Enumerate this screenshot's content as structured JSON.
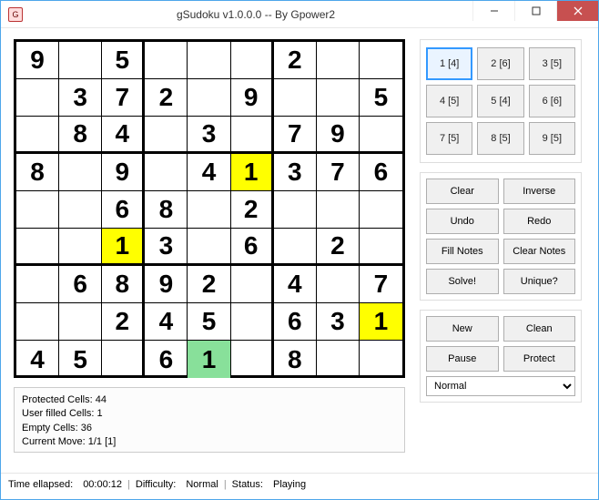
{
  "window": {
    "title": "gSudoku v1.0.0.0 -- By Gpower2",
    "app_icon_text": "G"
  },
  "sudoku": {
    "grid": [
      [
        "9",
        "",
        "5",
        "",
        "",
        "",
        "2",
        "",
        ""
      ],
      [
        "",
        "3",
        "7",
        "2",
        "",
        "9",
        "",
        "",
        "5"
      ],
      [
        "",
        "8",
        "4",
        "",
        "3",
        "",
        "7",
        "9",
        ""
      ],
      [
        "8",
        "",
        "9",
        "",
        "4",
        "1",
        "3",
        "7",
        "6"
      ],
      [
        "",
        "",
        "6",
        "8",
        "",
        "2",
        "",
        "",
        ""
      ],
      [
        "",
        "",
        "1",
        "3",
        "",
        "6",
        "",
        "2",
        ""
      ],
      [
        "",
        "6",
        "8",
        "9",
        "2",
        "",
        "4",
        "",
        "7"
      ],
      [
        "",
        "",
        "2",
        "4",
        "5",
        "",
        "6",
        "3",
        "1"
      ],
      [
        "4",
        "5",
        "",
        "6",
        "1",
        "",
        "8",
        "",
        ""
      ]
    ],
    "highlights": [
      [
        3,
        5
      ],
      [
        5,
        2
      ],
      [
        7,
        8
      ]
    ],
    "user_cells": [
      [
        8,
        4
      ]
    ]
  },
  "info": {
    "line1": "Protected Cells: 44",
    "line2": "User filled Cells: 1",
    "line3": "Empty Cells: 36",
    "line4": "Current Move: 1/1 [1]"
  },
  "numpad": [
    {
      "label": "1 [4]",
      "active": true
    },
    {
      "label": "2 [6]",
      "active": false
    },
    {
      "label": "3 [5]",
      "active": false
    },
    {
      "label": "4 [5]",
      "active": false
    },
    {
      "label": "5 [4]",
      "active": false
    },
    {
      "label": "6 [6]",
      "active": false
    },
    {
      "label": "7 [5]",
      "active": false
    },
    {
      "label": "8 [5]",
      "active": false
    },
    {
      "label": "9 [5]",
      "active": false
    }
  ],
  "actions1": {
    "clear": "Clear",
    "inverse": "Inverse",
    "undo": "Undo",
    "redo": "Redo",
    "fillnotes": "Fill Notes",
    "clearnotes": "Clear Notes",
    "solve": "Solve!",
    "unique": "Unique?"
  },
  "actions2": {
    "new": "New",
    "clean": "Clean",
    "pause": "Pause",
    "protect": "Protect"
  },
  "difficulty_select": "Normal",
  "status": {
    "time_label": "Time ellapsed:",
    "time_value": "00:00:12",
    "diff_label": "Difficulty:",
    "diff_value": "Normal",
    "status_label": "Status:",
    "status_value": "Playing"
  }
}
